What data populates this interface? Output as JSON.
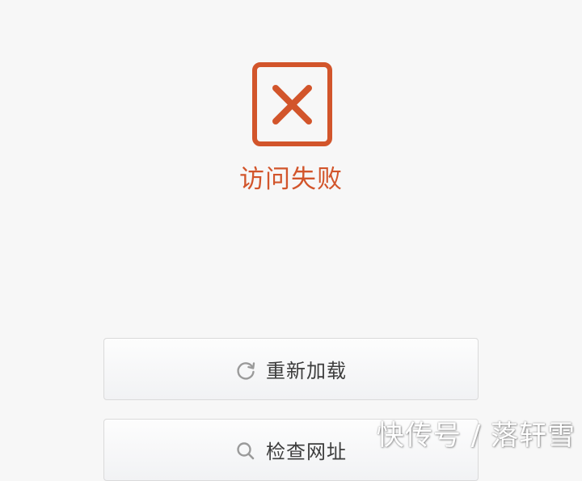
{
  "error": {
    "icon": "error-x-icon",
    "title": "访问失败",
    "color": "#d2552b"
  },
  "actions": {
    "reload": {
      "icon": "refresh-icon",
      "label": "重新加载"
    },
    "check": {
      "icon": "search-icon",
      "label": "检查网址"
    }
  },
  "watermark": {
    "text": "快传号 / 落轩雪"
  }
}
